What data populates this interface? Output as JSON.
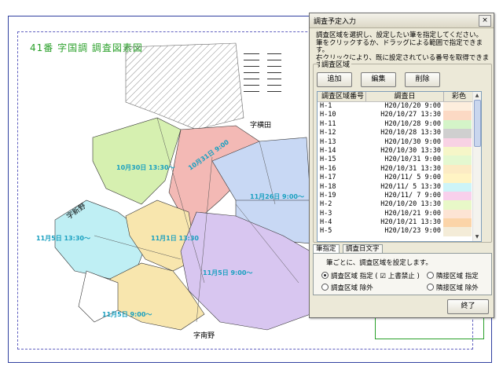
{
  "map": {
    "title": "41番 字国調 調査図素図",
    "area_labels": [
      "10月30日 13:30〜",
      "10月31日 9:00",
      "11月26日 9:00〜",
      "11月5日 13:30〜",
      "11月5日 9:00〜",
      "11月1日 13:30",
      "11月5日 9:00〜"
    ],
    "place_labels": [
      "字横田",
      "字新野",
      "字南野"
    ],
    "colors": {
      "green": "#d6f0b0",
      "pink": "#f3b9b5",
      "blue": "#c8d8f4",
      "cyan": "#bfeff4",
      "yellow": "#f8e6ae",
      "purple": "#d8c6f0",
      "hatch": "#999999"
    }
  },
  "dialog": {
    "title": "調査予定入力",
    "close_glyph": "×",
    "instruction_line1": "調査区域を選択し、設定したい筆を指定してください。",
    "instruction_line2": "筆をクリックするか、ドラッグによる範囲で指定できます。",
    "instruction_line3": "右クリックにより、既に設定されている番号を取得できます。",
    "group_label": "調査区域",
    "add_button": "追加",
    "edit_button": "編集",
    "delete_button": "削除",
    "columns": {
      "area_no": "調査区域番号",
      "date": "調査日",
      "color": "彩色"
    },
    "rows": [
      {
        "id": "H-1",
        "date": "H20/10/20  9:00",
        "color": "#fdeedd"
      },
      {
        "id": "H-10",
        "date": "H20/10/27 13:30",
        "color": "#fcd9c4"
      },
      {
        "id": "H-11",
        "date": "H20/10/28  9:00",
        "color": "#d4f4c8"
      },
      {
        "id": "H-12",
        "date": "H20/10/28 13:30",
        "color": "#cfcfcf"
      },
      {
        "id": "H-13",
        "date": "H20/10/30  9:00",
        "color": "#f8d2e4"
      },
      {
        "id": "H-14",
        "date": "H20/10/30 13:30",
        "color": "#f6f6c8"
      },
      {
        "id": "H-15",
        "date": "H20/10/31  9:00",
        "color": "#e4f8d0"
      },
      {
        "id": "H-16",
        "date": "H20/10/31 13:30",
        "color": "#fcebc4"
      },
      {
        "id": "H-17",
        "date": "H20/11/ 5  9:00",
        "color": "#fff4c4"
      },
      {
        "id": "H-18",
        "date": "H20/11/ 5 13:30",
        "color": "#cdf4f8"
      },
      {
        "id": "H-19",
        "date": "H20/11/ 7  9:00",
        "color": "#f8d0ec"
      },
      {
        "id": "H-2",
        "date": "H20/10/20 13:30",
        "color": "#e8f8c8"
      },
      {
        "id": "H-3",
        "date": "H20/10/21  9:00",
        "color": "#fde4d4"
      },
      {
        "id": "H-4",
        "date": "H20/10/21 13:30",
        "color": "#fbd4a8"
      },
      {
        "id": "H-5",
        "date": "H20/10/23  9:00",
        "color": "#f4ecd8"
      }
    ],
    "tab_fude": "筆指定",
    "tab_date": "調査日文字",
    "panel_desc": "筆ごとに、調査区域を設定します。",
    "radio_specify": "調査区域 指定 ( ☑ 上書禁止 )",
    "radio_exclude": "調査区域 除外",
    "radio_bound_specify": "隣接区域 指定",
    "radio_bound_exclude": "隣接区域 除外",
    "ok_button": "終了"
  }
}
